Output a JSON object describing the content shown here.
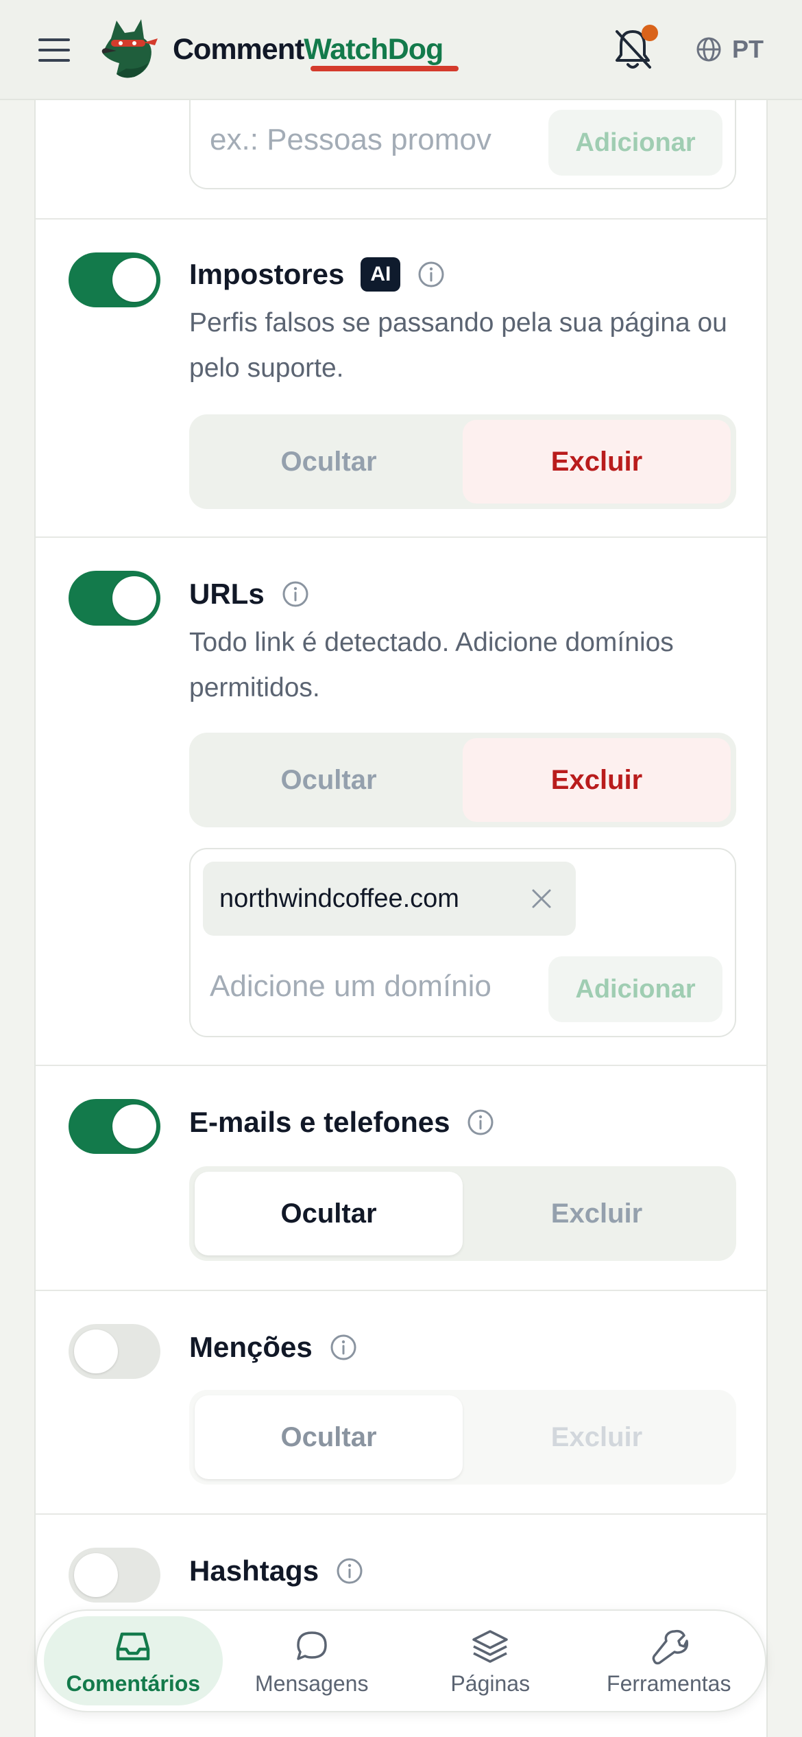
{
  "header": {
    "brand_part1": "Comment",
    "brand_part2": "WatchDog",
    "language": "PT"
  },
  "top_input": {
    "placeholder": "ex.: Pessoas promov",
    "add_label": "Adicionar"
  },
  "rules": [
    {
      "title": "Impostores",
      "badge": "AI",
      "enabled": true,
      "description": "Perfis falsos se passando pela sua página ou pelo suporte.",
      "hide_label": "Ocultar",
      "delete_label": "Excluir",
      "selected": "delete"
    },
    {
      "title": "URLs",
      "enabled": true,
      "description": "Todo link é detectado. Adicione domínios permitidos.",
      "hide_label": "Ocultar",
      "delete_label": "Excluir",
      "selected": "delete",
      "allowed_domains": [
        "northwindcoffee.com"
      ],
      "domain_placeholder": "Adicione um domínio",
      "add_label": "Adicionar"
    },
    {
      "title": "E-mails e telefones",
      "enabled": true,
      "hide_label": "Ocultar",
      "delete_label": "Excluir",
      "selected": "hide"
    },
    {
      "title": "Menções",
      "enabled": false,
      "hide_label": "Ocultar",
      "delete_label": "Excluir",
      "selected": "hide"
    },
    {
      "title": "Hashtags",
      "enabled": false
    }
  ],
  "bottom_nav": [
    {
      "label": "Comentários",
      "icon": "inbox-icon",
      "active": true
    },
    {
      "label": "Mensagens",
      "icon": "chat-bubble-icon",
      "active": false
    },
    {
      "label": "Páginas",
      "icon": "layers-icon",
      "active": false
    },
    {
      "label": "Ferramentas",
      "icon": "wrench-icon",
      "active": false
    }
  ],
  "colors": {
    "brand_green": "#137a4b",
    "brand_red": "#d43b2c",
    "delete_red": "#b91c1c",
    "notification_dot": "#d9631a"
  }
}
